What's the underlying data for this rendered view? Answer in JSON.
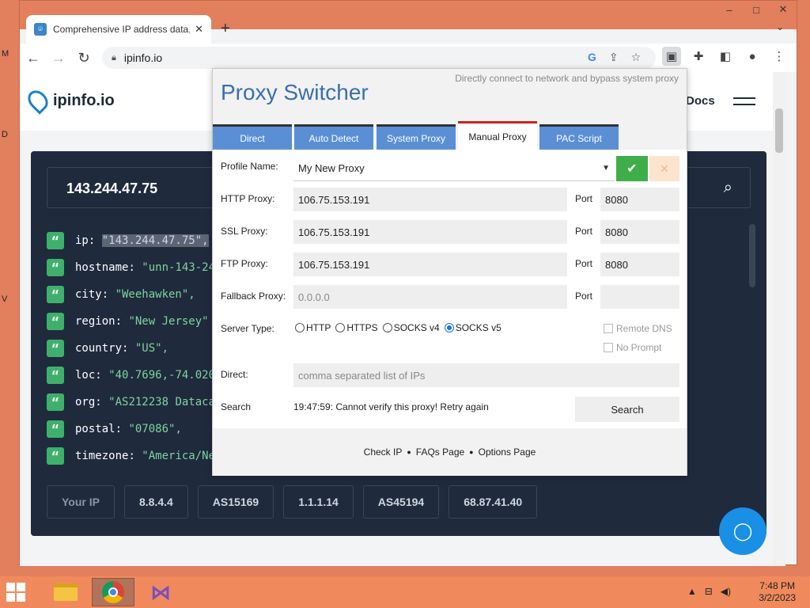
{
  "desktop": {
    "side_letters": [
      "M",
      "D",
      "V"
    ]
  },
  "window": {
    "controls": {
      "minimize": "–",
      "maximize": "□",
      "close": "✕"
    }
  },
  "browser": {
    "tab": {
      "title": "Comprehensive IP address data, I",
      "close": "✕"
    },
    "new_tab": "+",
    "tab_dropdown": "⌄",
    "url": "ipinfo.io",
    "icons": [
      "back-icon",
      "forward-icon",
      "reload-icon",
      "lock-icon",
      "google-icon",
      "share-icon",
      "star-icon",
      "proxy-extension-icon",
      "puzzle-icon",
      "sidepanel-icon",
      "profile-icon",
      "menu-icon"
    ]
  },
  "site": {
    "logo": "ipinfo.io",
    "docs": "Docs",
    "ip_value": "143.244.47.75",
    "json_lines": [
      {
        "key": "ip",
        "value": "\"143.244.47.75\",",
        "highlight": true
      },
      {
        "key": "hostname",
        "value": "\"unn-143-24",
        "highlight": false
      },
      {
        "key": "city",
        "value": "\"Weehawken\",",
        "highlight": false
      },
      {
        "key": "region",
        "value": "\"New Jersey\"",
        "highlight": false
      },
      {
        "key": "country",
        "value": "\"US\",",
        "highlight": false
      },
      {
        "key": "loc",
        "value": "\"40.7696,-74.020",
        "highlight": false
      },
      {
        "key": "org",
        "value": "\"AS212238 Dataca",
        "highlight": false
      },
      {
        "key": "postal",
        "value": "\"07086\",",
        "highlight": false
      },
      {
        "key": "timezone",
        "value": "\"America/Ne",
        "highlight": false
      }
    ],
    "buttons": [
      "Your IP",
      "8.8.4.4",
      "AS15169",
      "1.1.1.14",
      "AS45194",
      "68.87.41.40"
    ]
  },
  "proxy_switcher": {
    "title": "Proxy Switcher",
    "subtitle": "Directly connect to network and bypass system proxy",
    "tabs": [
      "Direct",
      "Auto Detect",
      "System Proxy",
      "Manual Proxy",
      "PAC Script"
    ],
    "selected_tab": "Manual Proxy",
    "profile_label": "Profile Name:",
    "profile_value": "My New Proxy",
    "ok_icon": "✔",
    "delete_icon": "✕",
    "http_label": "HTTP Proxy:",
    "http_value": "106.75.153.191",
    "http_port": "8080",
    "ssl_label": "SSL Proxy:",
    "ssl_value": "106.75.153.191",
    "ssl_port": "8080",
    "ftp_label": "FTP Proxy:",
    "ftp_value": "106.75.153.191",
    "ftp_port": "8080",
    "fallback_label": "Fallback Proxy:",
    "fallback_placeholder": "0.0.0.0",
    "port_label": "Port",
    "server_type_label": "Server Type:",
    "server_types": [
      "HTTP",
      "HTTPS",
      "SOCKS v4",
      "SOCKS v5"
    ],
    "selected_server_type": "SOCKS v5",
    "remote_dns": "Remote DNS",
    "no_prompt": "No Prompt",
    "direct_label": "Direct:",
    "direct_placeholder": "comma separated list of IPs",
    "search_label": "Search",
    "status": "19:47:59: Cannot verify this proxy! Retry again",
    "search_button": "Search",
    "footer_links": [
      "Check IP",
      "FAQs Page",
      "Options Page"
    ]
  },
  "taskbar": {
    "time": "7:48 PM",
    "date": "3/2/2023"
  }
}
